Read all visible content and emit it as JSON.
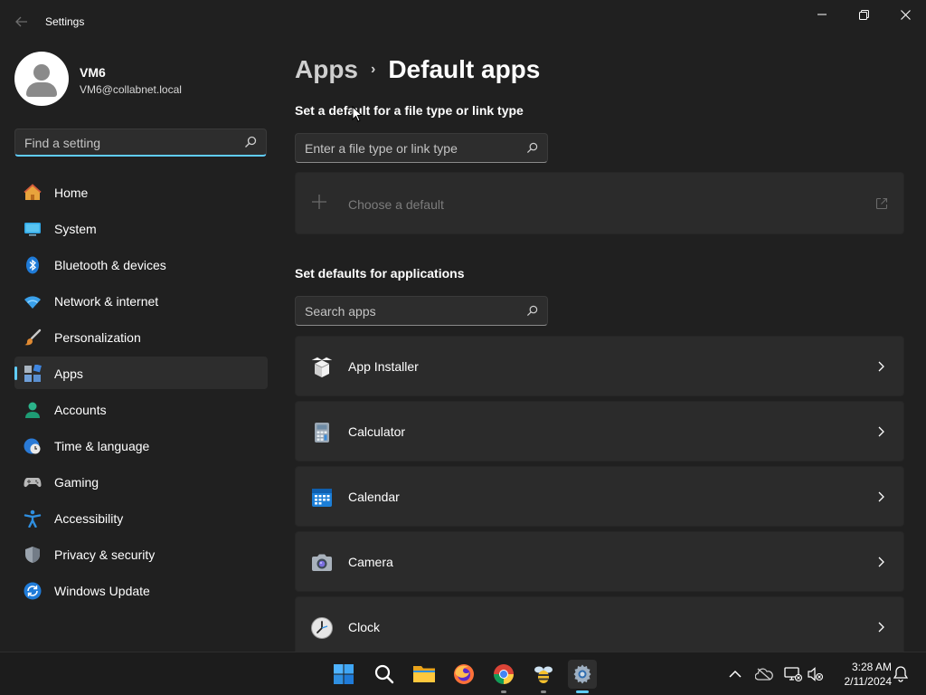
{
  "window": {
    "title": "Settings"
  },
  "profile": {
    "name": "VM6",
    "email": "VM6@collabnet.local"
  },
  "sidebar": {
    "search_placeholder": "Find a setting",
    "items": [
      {
        "label": "Home",
        "icon": "home-icon"
      },
      {
        "label": "System",
        "icon": "system-icon"
      },
      {
        "label": "Bluetooth & devices",
        "icon": "bluetooth-icon"
      },
      {
        "label": "Network & internet",
        "icon": "wifi-icon"
      },
      {
        "label": "Personalization",
        "icon": "brush-icon"
      },
      {
        "label": "Apps",
        "icon": "apps-icon",
        "selected": true
      },
      {
        "label": "Accounts",
        "icon": "accounts-icon"
      },
      {
        "label": "Time & language",
        "icon": "clock-globe-icon"
      },
      {
        "label": "Gaming",
        "icon": "gamepad-icon"
      },
      {
        "label": "Accessibility",
        "icon": "accessibility-icon"
      },
      {
        "label": "Privacy & security",
        "icon": "shield-icon"
      },
      {
        "label": "Windows Update",
        "icon": "update-icon"
      }
    ]
  },
  "breadcrumb": {
    "parent": "Apps",
    "separator": "›",
    "current": "Default apps"
  },
  "file_type_section": {
    "title": "Set a default for a file type or link type",
    "search_placeholder": "Enter a file type or link type",
    "choose_label": "Choose a default"
  },
  "apps_section": {
    "title": "Set defaults for applications",
    "search_placeholder": "Search apps",
    "apps": [
      {
        "name": "App Installer",
        "icon": "app-installer-icon"
      },
      {
        "name": "Calculator",
        "icon": "calculator-icon"
      },
      {
        "name": "Calendar",
        "icon": "calendar-icon"
      },
      {
        "name": "Camera",
        "icon": "camera-icon"
      },
      {
        "name": "Clock",
        "icon": "clock-icon"
      }
    ]
  },
  "taskbar": {
    "apps": [
      "start-icon",
      "search-icon",
      "file-explorer-icon",
      "firefox-icon",
      "chrome-icon",
      "bee-app-icon",
      "settings-icon"
    ],
    "tray": [
      "chevron-up-icon",
      "onedrive-icon",
      "network-icon",
      "volume-muted-icon",
      "notification-bell-icon"
    ],
    "time": "3:28 AM",
    "date": "2/11/2024"
  },
  "colors": {
    "accent": "#60cdff",
    "background": "#202020",
    "card": "#2b2b2b"
  }
}
